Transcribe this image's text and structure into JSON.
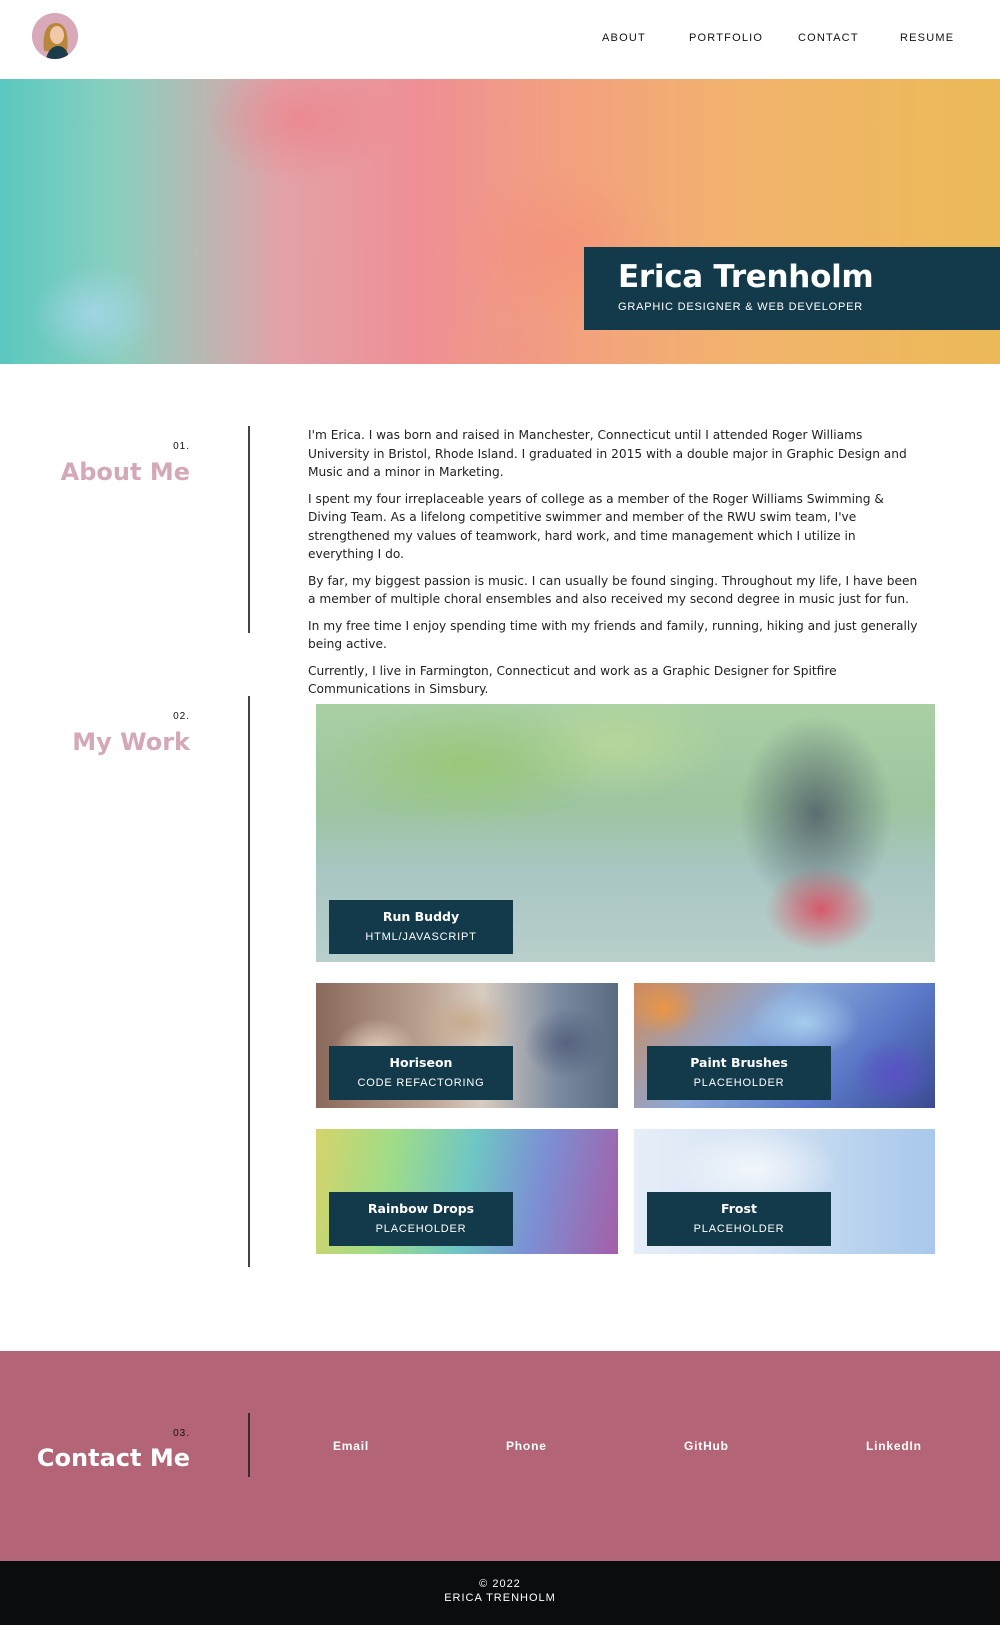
{
  "nav": {
    "items": [
      "ABOUT",
      "PORTFOLIO",
      "CONTACT",
      "RESUME"
    ]
  },
  "hero": {
    "name": "Erica Trenholm",
    "subtitle": "GRAPHIC DESIGNER & WEB DEVELOPER"
  },
  "about": {
    "number": "01.",
    "title": "About Me",
    "paragraphs": [
      "I'm Erica. I was born and raised in Manchester, Connecticut until I attended Roger Williams University in Bristol, Rhode Island. I graduated in 2015 with a double major in Graphic Design and Music and a minor in Marketing.",
      "I spent my four irreplaceable years of college as a member of the Roger Williams Swimming & Diving Team. As a lifelong competitive swimmer and member of the RWU swim team, I've strengthened my values of teamwork, hard work, and time management which I utilize in everything I do.",
      "By far, my biggest passion is music. I can usually be found singing. Throughout my life, I have been a member of multiple choral ensembles and also received my second degree in music just for fun.",
      "In my free time I enjoy spending time with my friends and family, running, hiking and just generally being active.",
      "Currently, I live in Farmington, Connecticut and work as a Graphic Designer for Spitfire Communications in Simsbury."
    ]
  },
  "work": {
    "number": "02.",
    "title": "My Work",
    "projects": [
      {
        "title": "Run Buddy",
        "subtitle": "HTML/JAVASCRIPT"
      },
      {
        "title": "Horiseon",
        "subtitle": "CODE REFACTORING"
      },
      {
        "title": "Paint Brushes",
        "subtitle": "PLACEHOLDER"
      },
      {
        "title": "Rainbow Drops",
        "subtitle": "PLACEHOLDER"
      },
      {
        "title": "Frost",
        "subtitle": "PLACEHOLDER"
      }
    ]
  },
  "contact": {
    "number": "03.",
    "title": "Contact Me",
    "links": [
      "Email",
      "Phone",
      "GitHub",
      "LinkedIn"
    ]
  },
  "footer": {
    "copyright": "© 2022",
    "name": "ERICA TRENHOLM"
  },
  "colors": {
    "navy": "#133a4b",
    "rose": "#b36476",
    "pink_heading": "#d4a8b8",
    "footer_bg": "#0b0c0e"
  }
}
